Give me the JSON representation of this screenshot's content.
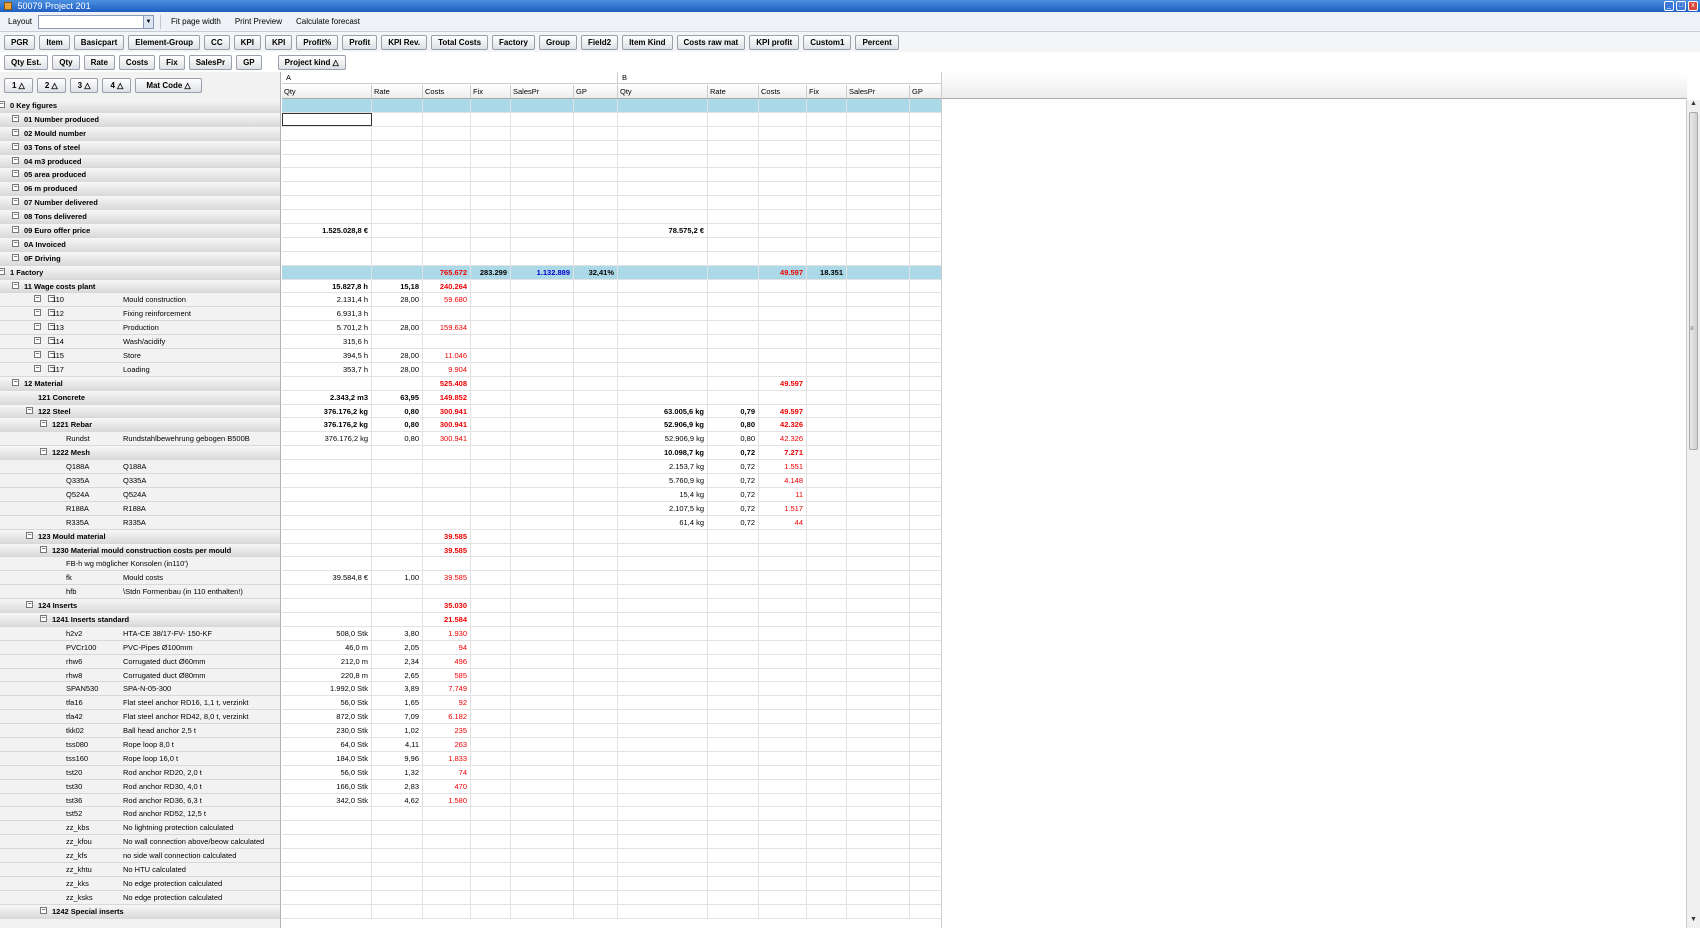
{
  "window": {
    "title": "50079 Project 201",
    "min": "_",
    "max": "□",
    "close": "x"
  },
  "toolbar": {
    "layout_label": "Layout",
    "fit_label": "Fit page width",
    "preview_label": "Print Preview",
    "forecast_label": "Calculate forecast"
  },
  "field_buttons": [
    "PGR",
    "Item",
    "Basicpart",
    "Element-Group",
    "CC",
    "KPI",
    "KPI",
    "Profit%",
    "Profit",
    "KPI Rev.",
    "Total Costs",
    "Factory",
    "Group",
    "Field2",
    "Item Kind",
    "Costs raw mat",
    "KPI profit",
    "Custom1",
    "Percent"
  ],
  "value_buttons": [
    "Qty Est.",
    "Qty",
    "Rate",
    "Costs",
    "Fix",
    "SalesPr",
    "GP"
  ],
  "column_field": "Project kind △",
  "level_buttons": [
    "1 △",
    "2 △",
    "3 △",
    "4 △",
    "Mat Code △"
  ],
  "column_groups": [
    {
      "label": "A"
    },
    {
      "label": "B"
    }
  ],
  "column_headers": [
    "Qty",
    "Rate",
    "Costs",
    "Fix",
    "SalesPr",
    "GP",
    "Qty",
    "Rate",
    "Costs",
    "Fix",
    "SalesPr",
    "GP"
  ],
  "rows": [
    {
      "code": "0 Key figures",
      "desc": "",
      "level": 0,
      "grp": true,
      "tog": "⊟",
      "hl": true,
      "cells": [
        "",
        "",
        "",
        "",
        "",
        "",
        "",
        "",
        "",
        "",
        "",
        ""
      ]
    },
    {
      "code": "01 Number produced",
      "desc": "",
      "level": 1,
      "grp": true,
      "tog": "⊟",
      "sel": 0,
      "cells": [
        "",
        "",
        "",
        "",
        "",
        "",
        "",
        "",
        "",
        "",
        "",
        ""
      ]
    },
    {
      "code": "02 Mould number",
      "desc": "",
      "level": 1,
      "grp": true,
      "tog": "⊟",
      "cells": [
        "",
        "",
        "",
        "",
        "",
        "",
        "",
        "",
        "",
        "",
        "",
        ""
      ]
    },
    {
      "code": "03 Tons of steel",
      "desc": "",
      "level": 1,
      "grp": true,
      "tog": "⊟",
      "cells": [
        "",
        "",
        "",
        "",
        "",
        "",
        "",
        "",
        "",
        "",
        "",
        ""
      ]
    },
    {
      "code": "04 m3 produced",
      "desc": "",
      "level": 1,
      "grp": true,
      "tog": "⊟",
      "cells": [
        "",
        "",
        "",
        "",
        "",
        "",
        "",
        "",
        "",
        "",
        "",
        ""
      ]
    },
    {
      "code": "05 area produced",
      "desc": "",
      "level": 1,
      "grp": true,
      "tog": "⊟",
      "cells": [
        "",
        "",
        "",
        "",
        "",
        "",
        "",
        "",
        "",
        "",
        "",
        ""
      ]
    },
    {
      "code": "06 m produced",
      "desc": "",
      "level": 1,
      "grp": true,
      "tog": "⊟",
      "cells": [
        "",
        "",
        "",
        "",
        "",
        "",
        "",
        "",
        "",
        "",
        "",
        ""
      ]
    },
    {
      "code": "07 Number delivered",
      "desc": "",
      "level": 1,
      "grp": true,
      "tog": "⊟",
      "cells": [
        "",
        "",
        "",
        "",
        "",
        "",
        "",
        "",
        "",
        "",
        "",
        ""
      ]
    },
    {
      "code": "08 Tons delivered",
      "desc": "",
      "level": 1,
      "grp": true,
      "tog": "⊟",
      "cells": [
        "",
        "",
        "",
        "",
        "",
        "",
        "",
        "",
        "",
        "",
        "",
        ""
      ]
    },
    {
      "code": "09 Euro offer price",
      "desc": "",
      "level": 1,
      "grp": true,
      "tog": "⊟",
      "cells": [
        "1.525.028,8 €",
        "",
        "",
        "",
        "",
        "",
        "78.575,2 €",
        "",
        "",
        "",
        "",
        ""
      ]
    },
    {
      "code": "0A Invoiced",
      "desc": "",
      "level": 1,
      "grp": true,
      "tog": "⊟",
      "cells": [
        "",
        "",
        "",
        "",
        "",
        "",
        "",
        "",
        "",
        "",
        "",
        ""
      ]
    },
    {
      "code": "0F Driving",
      "desc": "",
      "level": 1,
      "grp": true,
      "tog": "⊟",
      "cells": [
        "",
        "",
        "",
        "",
        "",
        "",
        "",
        "",
        "",
        "",
        "",
        ""
      ]
    },
    {
      "code": "1 Factory",
      "desc": "",
      "level": 0,
      "grp": true,
      "tog": "⊟",
      "hl": true,
      "cells": [
        "",
        "",
        "765.672",
        "283.299",
        "1.132.889",
        "32,41%",
        "",
        "",
        "49.597",
        "18.351",
        "",
        ""
      ]
    },
    {
      "code": "11 Wage costs plant",
      "desc": "",
      "level": 1,
      "grp": true,
      "tog": "⊟",
      "cells": [
        "15.827,8 h",
        "15,18",
        "240.264",
        "",
        "",
        "",
        "",
        "",
        "",
        "",
        "",
        ""
      ]
    },
    {
      "code": "110",
      "desc": "Mould construction",
      "level": 3,
      "tog2": true,
      "cells": [
        "2.131,4 h",
        "28,00",
        "59.680",
        "",
        "",
        "",
        "",
        "",
        "",
        "",
        "",
        ""
      ]
    },
    {
      "code": "112",
      "desc": "Fixing reinforcement",
      "level": 3,
      "tog2": true,
      "cells": [
        "6.931,3 h",
        "",
        "",
        "",
        "",
        "",
        "",
        "",
        "",
        "",
        "",
        ""
      ]
    },
    {
      "code": "113",
      "desc": "Production",
      "level": 3,
      "tog2": true,
      "cells": [
        "5.701,2 h",
        "28,00",
        "159.634",
        "",
        "",
        "",
        "",
        "",
        "",
        "",
        "",
        ""
      ]
    },
    {
      "code": "114",
      "desc": "Wash/acidify",
      "level": 3,
      "tog2": true,
      "cells": [
        "315,6 h",
        "",
        "",
        "",
        "",
        "",
        "",
        "",
        "",
        "",
        "",
        ""
      ]
    },
    {
      "code": "115",
      "desc": "Store",
      "level": 3,
      "tog2": true,
      "cells": [
        "394,5 h",
        "28,00",
        "11.046",
        "",
        "",
        "",
        "",
        "",
        "",
        "",
        "",
        ""
      ]
    },
    {
      "code": "117",
      "desc": "Loading",
      "level": 3,
      "tog2": true,
      "cells": [
        "353,7 h",
        "28,00",
        "9.904",
        "",
        "",
        "",
        "",
        "",
        "",
        "",
        "",
        ""
      ]
    },
    {
      "code": "12 Material",
      "desc": "",
      "level": 1,
      "grp": true,
      "tog": "⊟",
      "cells": [
        "",
        "",
        "525.408",
        "",
        "",
        "",
        "",
        "",
        "49.597",
        "",
        "",
        ""
      ]
    },
    {
      "code": "121 Concrete",
      "desc": "",
      "level": 2,
      "grp": true,
      "cells": [
        "2.343,2 m3",
        "63,95",
        "149.852",
        "",
        "",
        "",
        "",
        "",
        "",
        "",
        "",
        ""
      ]
    },
    {
      "code": "122 Steel",
      "desc": "",
      "level": 2,
      "grp": true,
      "tog": "⊟",
      "cells": [
        "376.176,2 kg",
        "0,80",
        "300.941",
        "",
        "",
        "",
        "63.005,6 kg",
        "0,79",
        "49.597",
        "",
        "",
        ""
      ]
    },
    {
      "code": "1221 Rebar",
      "desc": "",
      "level": 3,
      "grp": true,
      "tog": "⊟",
      "cells": [
        "376.176,2 kg",
        "0,80",
        "300.941",
        "",
        "",
        "",
        "52.906,9 kg",
        "0,80",
        "42.326",
        "",
        "",
        ""
      ]
    },
    {
      "code": "Rundst",
      "desc": "Rundstahlbewehrung  gebogen B500B",
      "level": 4,
      "cells": [
        "376.176,2 kg",
        "0,80",
        "300.941",
        "",
        "",
        "",
        "52.906,9 kg",
        "0,80",
        "42.326",
        "",
        "",
        ""
      ]
    },
    {
      "code": "1222 Mesh",
      "desc": "",
      "level": 3,
      "grp": true,
      "tog": "⊟",
      "cells": [
        "",
        "",
        "",
        "",
        "",
        "",
        "10.098,7 kg",
        "0,72",
        "7.271",
        "",
        "",
        ""
      ]
    },
    {
      "code": "Q188A",
      "desc": "Q188A",
      "level": 4,
      "cells": [
        "",
        "",
        "",
        "",
        "",
        "",
        "2.153,7 kg",
        "0,72",
        "1.551",
        "",
        "",
        ""
      ]
    },
    {
      "code": "Q335A",
      "desc": "Q335A",
      "level": 4,
      "cells": [
        "",
        "",
        "",
        "",
        "",
        "",
        "5.760,9 kg",
        "0,72",
        "4.148",
        "",
        "",
        ""
      ]
    },
    {
      "code": "Q524A",
      "desc": "Q524A",
      "level": 4,
      "cells": [
        "",
        "",
        "",
        "",
        "",
        "",
        "15,4 kg",
        "0,72",
        "11",
        "",
        "",
        ""
      ]
    },
    {
      "code": "R188A",
      "desc": "R188A",
      "level": 4,
      "cells": [
        "",
        "",
        "",
        "",
        "",
        "",
        "2.107,5 kg",
        "0,72",
        "1.517",
        "",
        "",
        ""
      ]
    },
    {
      "code": "R335A",
      "desc": "R335A",
      "level": 4,
      "cells": [
        "",
        "",
        "",
        "",
        "",
        "",
        "61,4 kg",
        "0,72",
        "44",
        "",
        "",
        ""
      ]
    },
    {
      "code": "123 Mould material",
      "desc": "",
      "level": 2,
      "grp": true,
      "tog": "⊟",
      "cells": [
        "",
        "",
        "39.585",
        "",
        "",
        "",
        "",
        "",
        "",
        "",
        "",
        ""
      ]
    },
    {
      "code": "1230 Material mould construction costs per mould",
      "desc": "",
      "level": 3,
      "grp": true,
      "tog": "⊟",
      "cells": [
        "",
        "",
        "39.585",
        "",
        "",
        "",
        "",
        "",
        "",
        "",
        "",
        ""
      ]
    },
    {
      "code": "FB-h wg möglicher Konsolen (in110')",
      "desc": "",
      "level": 4,
      "cells": [
        "",
        "",
        "",
        "",
        "",
        "",
        "",
        "",
        "",
        "",
        "",
        ""
      ]
    },
    {
      "code": "fk",
      "desc": "Mould costs",
      "level": 4,
      "cells": [
        "39.584,8 €",
        "1,00",
        "39.585",
        "",
        "",
        "",
        "",
        "",
        "",
        "",
        "",
        ""
      ]
    },
    {
      "code": "hfb",
      "desc": "\\Stdn Formenbau (in 110 enthalten!)",
      "level": 4,
      "cells": [
        "",
        "",
        "",
        "",
        "",
        "",
        "",
        "",
        "",
        "",
        "",
        ""
      ]
    },
    {
      "code": "124 Inserts",
      "desc": "",
      "level": 2,
      "grp": true,
      "tog": "⊟",
      "cells": [
        "",
        "",
        "35.030",
        "",
        "",
        "",
        "",
        "",
        "",
        "",
        "",
        ""
      ]
    },
    {
      "code": "1241 Inserts standard",
      "desc": "",
      "level": 3,
      "grp": true,
      "tog": "⊟",
      "cells": [
        "",
        "",
        "21.584",
        "",
        "",
        "",
        "",
        "",
        "",
        "",
        "",
        ""
      ]
    },
    {
      "code": "h2v2",
      "desc": "HTA-CE 38/17-FV-  150-KF",
      "level": 4,
      "cells": [
        "508,0 Stk",
        "3,80",
        "1.930",
        "",
        "",
        "",
        "",
        "",
        "",
        "",
        "",
        ""
      ]
    },
    {
      "code": "PVCr100",
      "desc": "PVC-Pipes Ø100mm",
      "level": 4,
      "cells": [
        "46,0 m",
        "2,05",
        "94",
        "",
        "",
        "",
        "",
        "",
        "",
        "",
        "",
        ""
      ]
    },
    {
      "code": "rhw6",
      "desc": "Corrugated duct Ø60mm",
      "level": 4,
      "cells": [
        "212,0 m",
        "2,34",
        "496",
        "",
        "",
        "",
        "",
        "",
        "",
        "",
        "",
        ""
      ]
    },
    {
      "code": "rhw8",
      "desc": "Corrugated duct Ø80mm",
      "level": 4,
      "cells": [
        "220,8 m",
        "2,65",
        "585",
        "",
        "",
        "",
        "",
        "",
        "",
        "",
        "",
        ""
      ]
    },
    {
      "code": "SPAN530",
      "desc": "SPA-N-05-300",
      "level": 4,
      "cells": [
        "1.992,0 Stk",
        "3,89",
        "7.749",
        "",
        "",
        "",
        "",
        "",
        "",
        "",
        "",
        ""
      ]
    },
    {
      "code": "tfa16",
      "desc": "Flat steel anchor RD16, 1,1 t, verzinkt",
      "level": 4,
      "cells": [
        "56,0 Stk",
        "1,65",
        "92",
        "",
        "",
        "",
        "",
        "",
        "",
        "",
        "",
        ""
      ]
    },
    {
      "code": "tfa42",
      "desc": "Flat steel anchor RD42, 8,0 t, verzinkt",
      "level": 4,
      "cells": [
        "872,0 Stk",
        "7,09",
        "6.182",
        "",
        "",
        "",
        "",
        "",
        "",
        "",
        "",
        ""
      ]
    },
    {
      "code": "tkk02",
      "desc": "Ball head anchor 2,5 t",
      "level": 4,
      "cells": [
        "230,0 Stk",
        "1,02",
        "235",
        "",
        "",
        "",
        "",
        "",
        "",
        "",
        "",
        ""
      ]
    },
    {
      "code": "tss080",
      "desc": "Rope loop 8,0 t",
      "level": 4,
      "cells": [
        "64,0 Stk",
        "4,11",
        "263",
        "",
        "",
        "",
        "",
        "",
        "",
        "",
        "",
        ""
      ]
    },
    {
      "code": "tss160",
      "desc": "Rope loop 16,0 t",
      "level": 4,
      "cells": [
        "184,0 Stk",
        "9,96",
        "1.833",
        "",
        "",
        "",
        "",
        "",
        "",
        "",
        "",
        ""
      ]
    },
    {
      "code": "tst20",
      "desc": "Rod anchor RD20, 2,0 t",
      "level": 4,
      "cells": [
        "56,0 Stk",
        "1,32",
        "74",
        "",
        "",
        "",
        "",
        "",
        "",
        "",
        "",
        ""
      ]
    },
    {
      "code": "tst30",
      "desc": "Rod anchor RD30, 4,0 t",
      "level": 4,
      "cells": [
        "166,0 Stk",
        "2,83",
        "470",
        "",
        "",
        "",
        "",
        "",
        "",
        "",
        "",
        ""
      ]
    },
    {
      "code": "tst36",
      "desc": "Rod anchor RD36, 6,3 t",
      "level": 4,
      "cells": [
        "342,0 Stk",
        "4,62",
        "1.580",
        "",
        "",
        "",
        "",
        "",
        "",
        "",
        "",
        ""
      ]
    },
    {
      "code": "tst52",
      "desc": "Rod anchor RD52, 12,5 t",
      "level": 4,
      "cells": [
        "",
        "",
        "",
        "",
        "",
        "",
        "",
        "",
        "",
        "",
        "",
        ""
      ]
    },
    {
      "code": "zz_kbs",
      "desc": "No lightning protection calculated",
      "level": 4,
      "cells": [
        "",
        "",
        "",
        "",
        "",
        "",
        "",
        "",
        "",
        "",
        "",
        ""
      ]
    },
    {
      "code": "zz_kfou",
      "desc": "No wall connection above/beow calculated",
      "level": 4,
      "cells": [
        "",
        "",
        "",
        "",
        "",
        "",
        "",
        "",
        "",
        "",
        "",
        ""
      ]
    },
    {
      "code": "zz_kfs",
      "desc": "no side wall connection calculated",
      "level": 4,
      "cells": [
        "",
        "",
        "",
        "",
        "",
        "",
        "",
        "",
        "",
        "",
        "",
        ""
      ]
    },
    {
      "code": "zz_khtu",
      "desc": "No HTU calculated",
      "level": 4,
      "cells": [
        "",
        "",
        "",
        "",
        "",
        "",
        "",
        "",
        "",
        "",
        "",
        ""
      ]
    },
    {
      "code": "zz_kks",
      "desc": "No edge protection calculated",
      "level": 4,
      "cells": [
        "",
        "",
        "",
        "",
        "",
        "",
        "",
        "",
        "",
        "",
        "",
        ""
      ]
    },
    {
      "code": "zz_ksks",
      "desc": "No edge protection calculated",
      "level": 4,
      "cells": [
        "",
        "",
        "",
        "",
        "",
        "",
        "",
        "",
        "",
        "",
        "",
        ""
      ]
    },
    {
      "code": "1242 Special inserts",
      "desc": "",
      "level": 3,
      "grp": true,
      "tog": "⊟",
      "cells": [
        "",
        "",
        "",
        "",
        "",
        "",
        "",
        "",
        "",
        "",
        "",
        ""
      ]
    }
  ],
  "colors": {
    "highlight": "#acd9e8",
    "cost_red": "#e00000",
    "sales_blue": "#0000cc",
    "title_blue": "#1f5fc0"
  }
}
